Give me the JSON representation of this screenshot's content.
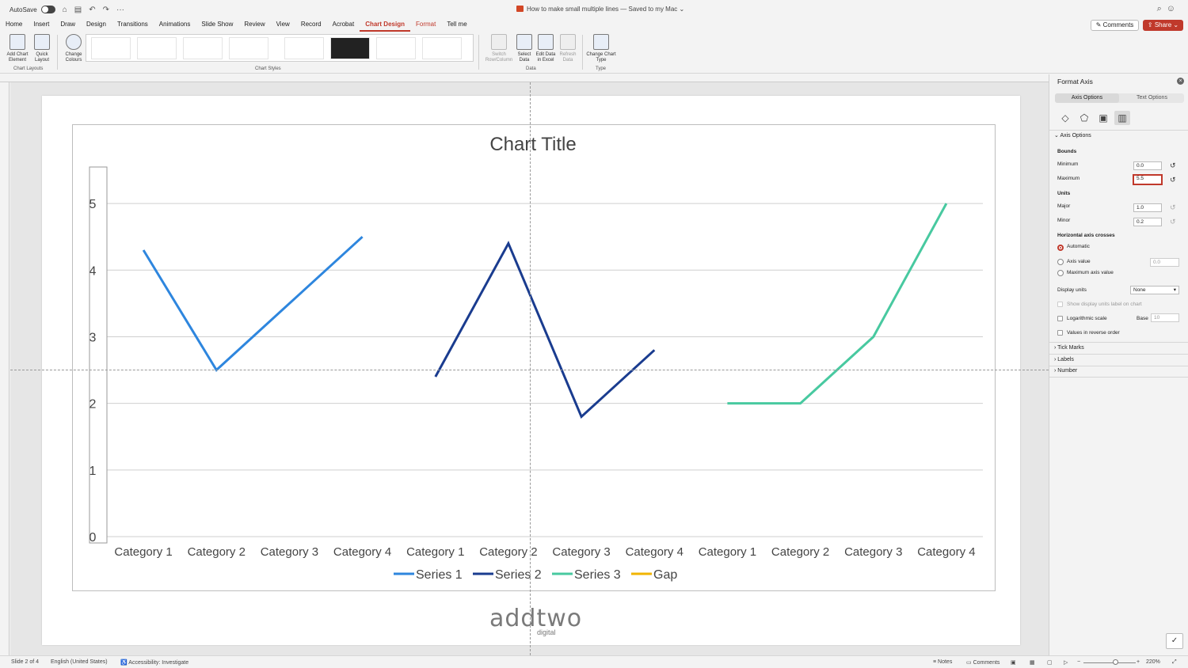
{
  "titlebar": {
    "autosave_label": "AutoSave",
    "document_title": "How to make small multiple lines — Saved to my Mac ⌄",
    "icons": [
      "home-icon",
      "save-icon",
      "undo-icon",
      "redo-icon",
      "more-icon",
      "search-icon",
      "account-icon"
    ]
  },
  "tabs": [
    "Home",
    "Insert",
    "Draw",
    "Design",
    "Transitions",
    "Animations",
    "Slide Show",
    "Review",
    "View",
    "Record",
    "Acrobat",
    "Chart Design",
    "Format",
    "Tell me"
  ],
  "active_tab": "Chart Design",
  "buttons": {
    "comments": "Comments",
    "share": "Share"
  },
  "ribbon": {
    "add_chart_element": "Add Chart Element",
    "quick_layout": "Quick Layout",
    "change_colours": "Change Colours",
    "switch_row_column": "Switch Row/Column",
    "select_data": "Select Data",
    "edit_data_in_excel": "Edit Data in Excel",
    "refresh_data": "Refresh Data",
    "change_chart_type": "Change Chart Type",
    "group_chart_layouts": "Chart Layouts",
    "group_chart_styles": "Chart Styles",
    "group_data": "Data",
    "group_type": "Type"
  },
  "chart_data": {
    "type": "line",
    "title": "Chart Title",
    "categories": [
      "Category 1",
      "Category 2",
      "Category 3",
      "Category 4"
    ],
    "panels": 3,
    "yaxis": {
      "min": 0,
      "max": 5.5,
      "major": 1,
      "ticks": [
        "0",
        "1",
        "2",
        "3",
        "4",
        "5"
      ]
    },
    "grid": true,
    "legend_position": "bottom",
    "series": [
      {
        "name": "Series 1",
        "panel": 0,
        "values": [
          4.3,
          2.5,
          3.5,
          4.5
        ],
        "color": "#2e86de"
      },
      {
        "name": "Series 2",
        "panel": 1,
        "values": [
          2.4,
          4.4,
          1.8,
          2.8
        ],
        "color": "#1a3c8f"
      },
      {
        "name": "Series 3",
        "panel": 2,
        "values": [
          2.0,
          2.0,
          3.0,
          5.0
        ],
        "color": "#48c9a0"
      },
      {
        "name": "Gap",
        "panel": null,
        "values": [],
        "color": "#f1b400"
      }
    ]
  },
  "logo": {
    "main": "addtwo",
    "sub": "digital"
  },
  "format_pane": {
    "title": "Format Axis",
    "tab_axis_options": "Axis Options",
    "tab_text_options": "Text Options",
    "section_axis_options": "Axis Options",
    "bounds": "Bounds",
    "minimum_label": "Minimum",
    "minimum_value": "0.0",
    "maximum_label": "Maximum",
    "maximum_value": "5.5",
    "units": "Units",
    "major_label": "Major",
    "major_value": "1.0",
    "minor_label": "Minor",
    "minor_value": "0.2",
    "h_axis_crosses": "Horizontal axis crosses",
    "automatic": "Automatic",
    "axis_value": "Axis value",
    "axis_value_value": "0.0",
    "max_axis_value": "Maximum axis value",
    "display_units": "Display units",
    "display_units_value": "None",
    "show_display_units": "Show display units label on chart",
    "log_scale": "Logarithmic scale",
    "base_label": "Base",
    "base_value": "10",
    "reverse_order": "Values in reverse order",
    "tick_marks": "Tick Marks",
    "labels": "Labels",
    "number": "Number"
  },
  "status": {
    "slide": "Slide 2 of 4",
    "language": "English (United States)",
    "accessibility": "Accessibility: Investigate",
    "notes": "Notes",
    "comments": "Comments",
    "zoom": "220%"
  }
}
